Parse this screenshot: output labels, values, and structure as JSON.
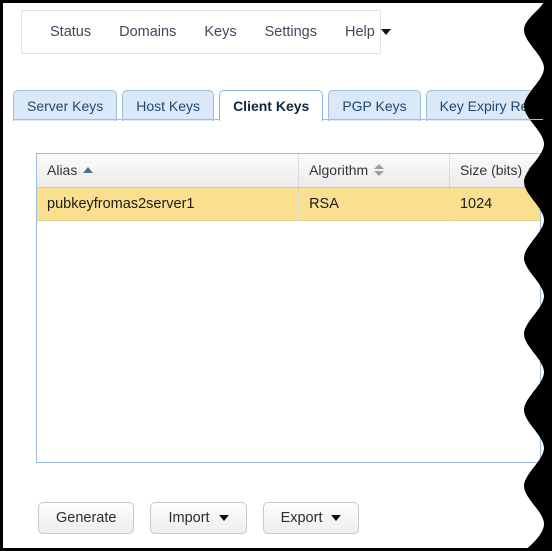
{
  "menubar": {
    "items": [
      {
        "label": "Status",
        "has_caret": false
      },
      {
        "label": "Domains",
        "has_caret": false
      },
      {
        "label": "Keys",
        "has_caret": false
      },
      {
        "label": "Settings",
        "has_caret": false
      },
      {
        "label": "Help",
        "has_caret": true,
        "caret_icon": "chevron-down-icon"
      }
    ]
  },
  "tabs": [
    {
      "label": "Server Keys",
      "active": false
    },
    {
      "label": "Host Keys",
      "active": false
    },
    {
      "label": "Client Keys",
      "active": true
    },
    {
      "label": "PGP Keys",
      "active": false
    },
    {
      "label": "Key Expiry Report",
      "active": false
    }
  ],
  "table": {
    "columns": [
      {
        "label": "Alias",
        "sort": "ascending",
        "sort_icon": "sort-ascending-icon"
      },
      {
        "label": "Algorithm",
        "sort": "none",
        "sort_icon": "sort-none-icon"
      },
      {
        "label": "Size (bits)",
        "sort": "none",
        "sort_icon": "sort-none-icon"
      }
    ],
    "rows": [
      {
        "alias": "pubkeyfromas2server1",
        "algorithm": "RSA",
        "size": "1024",
        "selected": true
      }
    ]
  },
  "buttons": [
    {
      "label": "Generate",
      "has_caret": false
    },
    {
      "label": "Import",
      "has_caret": true,
      "caret_icon": "chevron-down-icon"
    },
    {
      "label": "Export",
      "has_caret": true,
      "caret_icon": "chevron-down-icon"
    }
  ],
  "colors": {
    "tab_active_text": "#10283f",
    "tab_inactive_bg": "#dbe8f8",
    "tab_border": "#9dbde2",
    "row_selected_bg": "#fadf8f",
    "frame": "#000000"
  }
}
